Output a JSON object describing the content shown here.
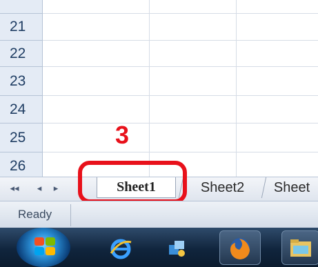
{
  "grid": {
    "rows": [
      "21",
      "22",
      "23",
      "24",
      "25",
      "26"
    ]
  },
  "tabs": {
    "nav_first": "◂◂",
    "nav_prev": "◂",
    "nav_next": "▸",
    "sheets": [
      "Sheet1",
      "Sheet2",
      "Sheet"
    ],
    "active_index": 0
  },
  "annotation": {
    "step_number": "3",
    "color": "#e8111b"
  },
  "status_bar": {
    "text": "Ready"
  },
  "taskbar": {
    "items": [
      "start-orb-icon",
      "internet-explorer-icon",
      "network-icon",
      "firefox-icon",
      "windows-explorer-icon"
    ]
  }
}
